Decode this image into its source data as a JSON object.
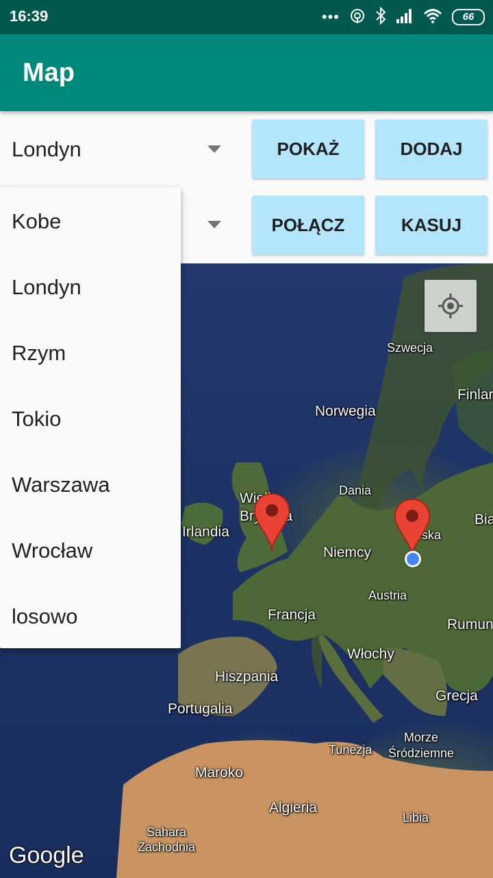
{
  "status_bar": {
    "time": "16:39",
    "battery": "66",
    "icons": [
      "more-dots-icon",
      "hotspot-icon",
      "bluetooth-icon",
      "signal-icon",
      "wifi-icon",
      "battery-icon"
    ]
  },
  "app_bar": {
    "title": "Map",
    "color": "#00897b"
  },
  "spinner_top": {
    "value": "Londyn"
  },
  "spinner_bottom": {
    "value": ""
  },
  "buttons": {
    "show": "POKAŻ",
    "add": "DODAJ",
    "connect": "POŁĄCZ",
    "delete": "KASUJ",
    "color": "#b3e5fc"
  },
  "dropdown": {
    "items": [
      "Kobe",
      "Londyn",
      "Rzym",
      "Tokio",
      "Warszawa",
      "Wrocław",
      "losowo"
    ]
  },
  "map": {
    "labels": {
      "sweden": "Szwecja",
      "finland": "Finlar",
      "norway": "Norwegia",
      "denmark": "Dania",
      "britain": "Wielka Brytania",
      "ireland": "Irlandia",
      "poland": "Polska",
      "belarus": "Bia",
      "germany": "Niemcy",
      "austria": "Austria",
      "france": "Francja",
      "romania": "Rumun",
      "italy": "Włochy",
      "spain": "Hiszpania",
      "portugal": "Portugalia",
      "greece": "Grecja",
      "tunisia": "Tunezja",
      "sea": "Morze Śródziemne",
      "morocco": "Maroko",
      "algeria": "Algieria",
      "libya": "Libia",
      "western_sahara": "Sahara Zachodnia"
    },
    "markers": [
      "Londyn",
      "Warszawa"
    ],
    "logo": "Google",
    "marker_color": "#ea4335"
  }
}
